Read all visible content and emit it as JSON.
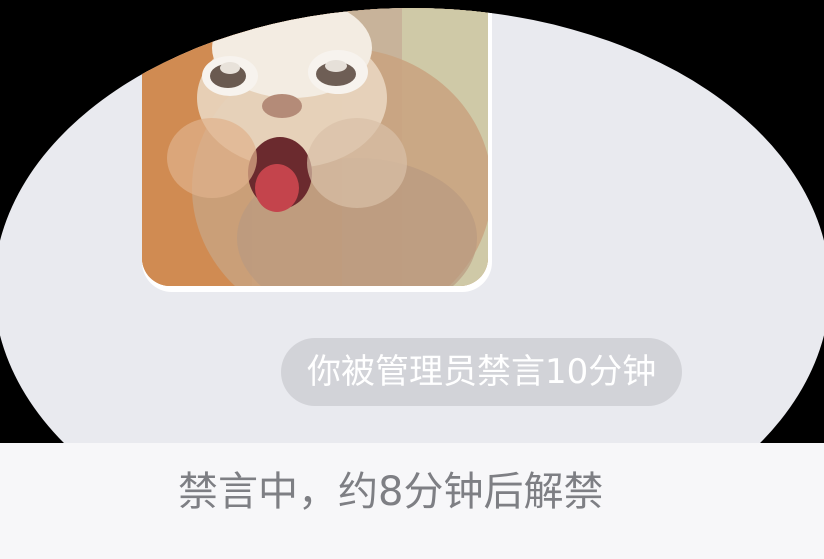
{
  "chat": {
    "image_message": {
      "icon": "cat-photo"
    },
    "system_notice": "你被管理员禁言10分钟"
  },
  "input_bar": {
    "muted_text": "禁言中，约8分钟后解禁"
  },
  "colors": {
    "background": "#e9eaef",
    "notice_bg": "#d2d3d8",
    "notice_text": "#ffffff",
    "muted_text": "#7e7f84",
    "bar_bg": "#f7f7f9"
  }
}
